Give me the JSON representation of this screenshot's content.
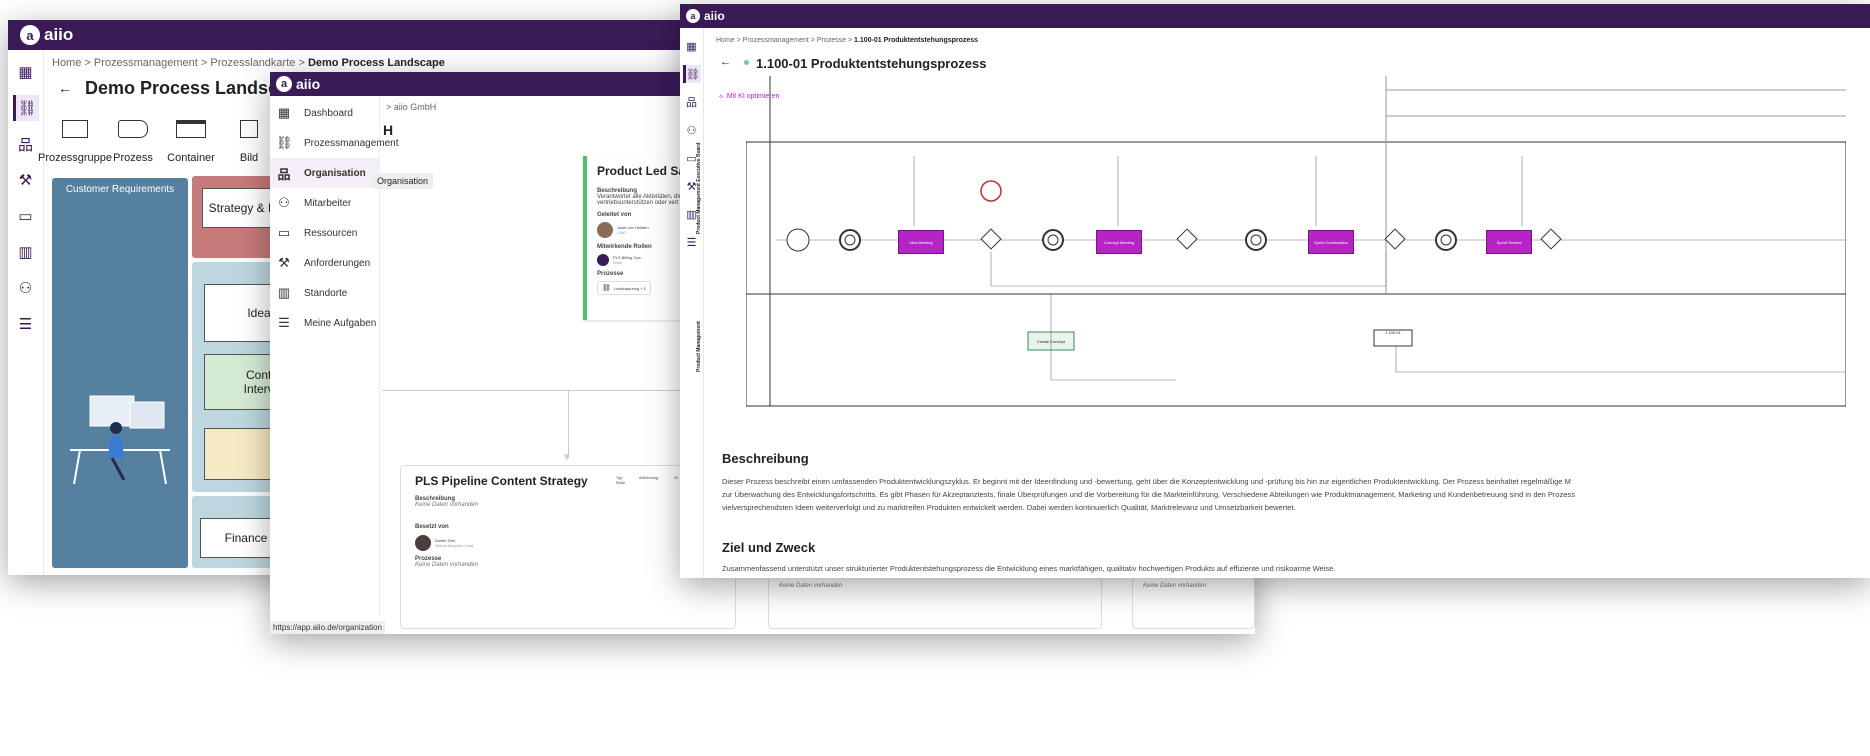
{
  "brand": {
    "name": "aiio",
    "mark": "a",
    "bar_color": "#3b1b57",
    "accent": "#b624c6"
  },
  "win1": {
    "breadcrumb": [
      "Home",
      "Prozessmanagement",
      "Prozesslandkarte",
      "Demo Process Landscape"
    ],
    "title": "Demo Process Landscape",
    "tools": [
      {
        "label": "Prozessgruppe"
      },
      {
        "label": "Prozess"
      },
      {
        "label": "Container"
      },
      {
        "label": "Bild"
      }
    ],
    "lanes": {
      "customer": "Customer Requirements",
      "strategy": "Strategy & Pla",
      "ideation": "Ideati",
      "contin": "Conti",
      "interv": "Intervi",
      "finance": "Finance"
    }
  },
  "win2": {
    "menu": [
      {
        "label": "Dashboard",
        "icon": "dashboard-icon"
      },
      {
        "label": "Prozessmanagement",
        "icon": "process-icon"
      },
      {
        "label": "Organisation",
        "icon": "org-icon",
        "active": true
      },
      {
        "label": "Mitarbeiter",
        "icon": "people-icon"
      },
      {
        "label": "Ressourcen",
        "icon": "folder-icon"
      },
      {
        "label": "Anforderungen",
        "icon": "gavel-icon"
      },
      {
        "label": "Standorte",
        "icon": "building-icon"
      },
      {
        "label": "Meine Aufgaben",
        "icon": "tasks-icon"
      }
    ],
    "tooltip": "Organisation",
    "breadcrumb_tail": "aiio GmbH",
    "heading_letter": "H",
    "card1": {
      "title": "Product Led Sal",
      "beschreibung_label": "Beschreibung",
      "beschreibung_text1": "Verantwortet alle Aktivitäten, die",
      "beschreibung_text2": "vertriebsunterstützen oder vert",
      "geleitet_label": "Geleitet von",
      "person_name": "Juliet von Hellden",
      "person_role": "CMO",
      "rollen_label": "Mitwirkende Rollen",
      "role1": "PLS Billing Ops",
      "role1_sub": "Rolle",
      "prozesse_label": "Prozesse",
      "process1": "Leadcapturing + 2"
    },
    "card2": {
      "title": "PLS Pipeline Content Strategy",
      "col1": "Typ",
      "col1_val": "Rolle",
      "col2": "Abkürzung",
      "col3": "St",
      "beschreibung_label": "Beschreibung",
      "no_data": "Keine Daten vorhanden",
      "besetzt_label": "Besetzt von",
      "person_name": "Dustin Zinn",
      "person_sub": "Global Adoption Lead",
      "prozesse_label": "Prozesse",
      "prozesse_no_data": "Keine Daten vorhanden"
    },
    "bottom_no_data_1": "Keine Daten vorhanden",
    "bottom_no_data_2": "Keine Daten vorhanden",
    "status_url": "https://app.aiio.de/organization"
  },
  "win3": {
    "breadcrumb": [
      "Home",
      "Prozessmanagement",
      "Prozesse",
      "1.100-01 Produktentstehungsprozess"
    ],
    "title": "1.100-01 Produktentstehungsprozess",
    "ai_button": "Mit KI optimieren",
    "lane1": "Product Management Executive Board",
    "lane2": "Product Management",
    "tasks": [
      "Idea Meeting",
      "Concept Meeting",
      "Sprint Continuation",
      "Sprint Review"
    ],
    "create_concept": "Create Concept",
    "small_box": "1.100-01",
    "beschreibung_h": "Beschreibung",
    "beschreibung_1": "Dieser Prozess beschreibt einen umfassenden Produktentwicklungszyklus. Er beginnt mit der Ideenfindung und -bewertung, geht über die Konzeptentwicklung und -prüfung bis hin zur eigentlichen Produktentwicklung. Der Prozess beinhaltet regelmäßige M",
    "beschreibung_2": "zur Überwachung des Entwicklungsfortschritts. Es gibt Phasen für Akzeptanztests, finale Überprüfungen und die Vorbereitung für die Markteinführung. Verschiedene Abteilungen wie Produktmanagement, Marketing und Kundenbetreuung sind in den Prozess",
    "beschreibung_3": "vielversprechendsten Ideen weiterverfolgt und zu marktreifen Produkten entwickelt werden. Dabei werden kontinuierlich Qualität, Marktrelevanz und Umsetzbarkeit bewertet.",
    "ziel_h": "Ziel und Zweck",
    "ziel_text": "Zusammenfassend unterstützt unser strukturierter Produktentstehungsprozess die Entwicklung eines marktfähigen, qualitativ hochwertigen Produkts auf effiziente und risikoarme Weise."
  }
}
